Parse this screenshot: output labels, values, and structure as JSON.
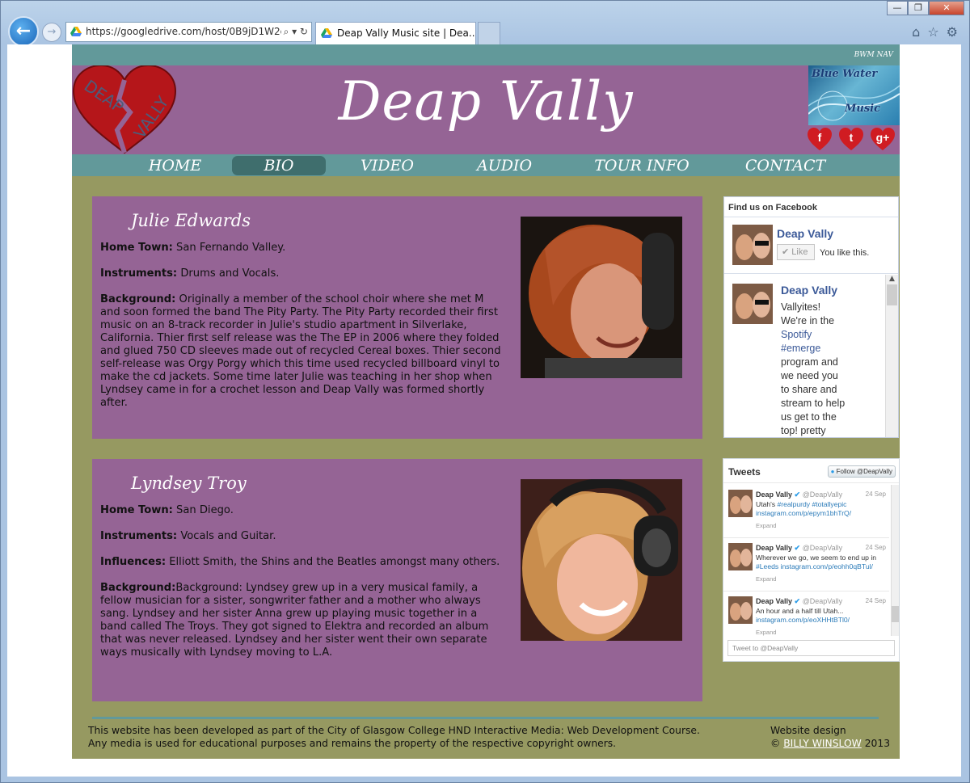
{
  "browser": {
    "url": "https://googledrive.com/host/0B9jD1W2c(",
    "tab_title": "Deap Vally Music site | Dea...",
    "back_glyph": "←",
    "forward_glyph": "→",
    "window_buttons": [
      "—",
      "❐",
      "✕"
    ],
    "addr_tools": "⌕ ▾ ↻",
    "tool_icons": [
      "home-icon",
      "star-icon",
      "gear-icon"
    ]
  },
  "site": {
    "topnav_label": "BWM NAV",
    "title": "Deap Vally",
    "logo_text": [
      "DEAP",
      "VALLY"
    ],
    "bwm_text": [
      "Blue Water",
      "Music"
    ],
    "social": [
      "f",
      "t",
      "g+"
    ],
    "nav": [
      "HOME",
      "BIO",
      "VIDEO",
      "AUDIO",
      "TOUR INFO",
      "CONTACT"
    ],
    "active_nav": "BIO"
  },
  "members": [
    {
      "name": "Julie Edwards",
      "fields": [
        {
          "label": "Home Town:",
          "value": " San Fernando Valley."
        },
        {
          "label": "Instruments:",
          "value": " Drums and Vocals."
        },
        {
          "label": "Background:",
          "value": " Originally a member of the school choir where she met M and soon formed the band The Pity Party. The Pity Party recorded their first music on an 8-track recorder in Julie's studio apartment in Silverlake, California. Thier first self release was the The EP in 2006 where they folded and glued 750 CD sleeves made out of recycled Cereal boxes. Thier second self-release was Orgy Porgy which this time used recycled billboard vinyl to make the cd jackets. Some time later Julie was teaching in her shop when Lyndsey came in for a crochet lesson and Deap Vally was formed shortly after."
        }
      ]
    },
    {
      "name": "Lyndsey Troy",
      "fields": [
        {
          "label": "Home Town:",
          "value": " San Diego."
        },
        {
          "label": "Instruments:",
          "value": " Vocals and Guitar."
        },
        {
          "label": "Influences:",
          "value": " Elliott Smith, the Shins and the Beatles amongst many others."
        },
        {
          "label": "Background:",
          "value": "Background: Lyndsey grew up in a very musical family, a fellow musician for a sister, songwriter father and a mother who always sang. Lyndsey and her sister Anna grew up playing music together in a band called The Troys. They got signed to Elektra and recorded an album that was never released. Lyndsey and her sister went their own separate ways musically with Lyndsey moving to L.A."
        }
      ]
    }
  ],
  "facebook": {
    "header": "Find us on Facebook",
    "page_name": "Deap Vally",
    "like_label": "Like",
    "like_status": "You like this.",
    "post_author": "Deap Vally",
    "post_lines": [
      "Vallyites!",
      "We're in the",
      "Spotify",
      "#emerge",
      "program and",
      "we need you",
      "to share and",
      "stream to help",
      "us get to the",
      "top! pretty"
    ]
  },
  "twitter": {
    "header": "Tweets",
    "follow_label": "Follow @DeapVally",
    "input_placeholder": "Tweet to @DeapVally",
    "tweets": [
      {
        "name": "Deap Vally",
        "handle": "@DeapVally",
        "date": "24 Sep",
        "text_a": "Utah's ",
        "link": "#realpurdy #totallyepic instagram.com/p/epym1bhTrQ/",
        "text_b": "",
        "expand": "Expand"
      },
      {
        "name": "Deap Vally",
        "handle": "@DeapVally",
        "date": "24 Sep",
        "text_a": "Wherever we go, we seem to end up in ",
        "link": "#Leeds instagram.com/p/eohh0qBTul/",
        "text_b": "",
        "expand": "Expand"
      },
      {
        "name": "Deap Vally",
        "handle": "@DeapVally",
        "date": "24 Sep",
        "text_a": "An hour and a half till Utah... ",
        "link": "instagram.com/p/eoXHHtBTl0/",
        "text_b": "",
        "expand": "Expand"
      }
    ]
  },
  "footer": {
    "line1": "This website has been developed as part of the City of Glasgow College HND Interactive Media: Web Development Course.",
    "line2": "Any media is used for educational purposes and remains the property of the respective copyright owners.",
    "credit_label": "Website design",
    "copyright": "©",
    "author": "BILLY WINSLOW",
    "year": "2013"
  }
}
